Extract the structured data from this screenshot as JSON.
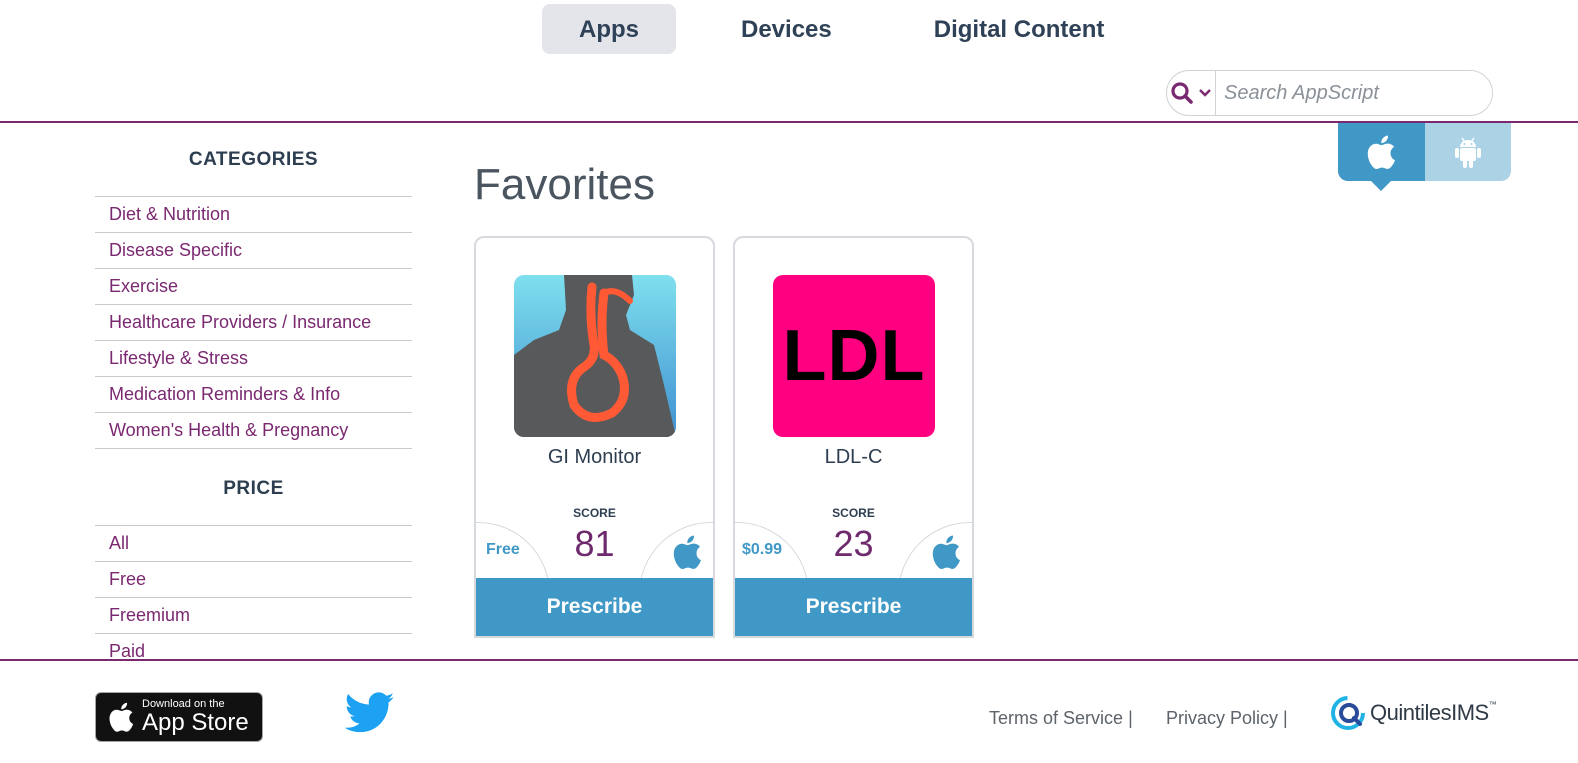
{
  "nav": {
    "tabs": [
      {
        "label": "Apps",
        "active": true
      },
      {
        "label": "Devices",
        "active": false
      },
      {
        "label": "Digital Content",
        "active": false
      }
    ]
  },
  "search": {
    "placeholder": "Search AppScript",
    "value": ""
  },
  "platform": {
    "selected": "ios",
    "options": [
      "ios",
      "android"
    ]
  },
  "sidebar": {
    "categories_heading": "CATEGORIES",
    "categories": [
      "Diet & Nutrition",
      "Disease Specific",
      "Exercise",
      "Healthcare Providers / Insurance",
      "Lifestyle & Stress",
      "Medication Reminders & Info",
      "Women's Health & Pregnancy"
    ],
    "price_heading": "PRICE",
    "prices": [
      "All",
      "Free",
      "Freemium",
      "Paid"
    ]
  },
  "main": {
    "title": "Favorites",
    "cards": [
      {
        "name": "GI Monitor",
        "score_label": "SCORE",
        "score": "81",
        "price": "Free",
        "button": "Prescribe",
        "platform_icon": "apple-icon"
      },
      {
        "name": "LDL-C",
        "score_label": "SCORE",
        "score": "23",
        "price": "$0.99",
        "button": "Prescribe",
        "platform_icon": "apple-icon",
        "icon_text": "LDL"
      }
    ]
  },
  "footer": {
    "appstore_small": "Download on the",
    "appstore_big": "App Store",
    "terms": "Terms of Service",
    "privacy": "Privacy Policy",
    "separator": "|",
    "brand": "QuintilesIMS",
    "brand_tm": "™"
  },
  "colors": {
    "accent_purple": "#7a2870",
    "accent_blue": "#3f98c6",
    "ldl_pink": "#ff0080"
  }
}
